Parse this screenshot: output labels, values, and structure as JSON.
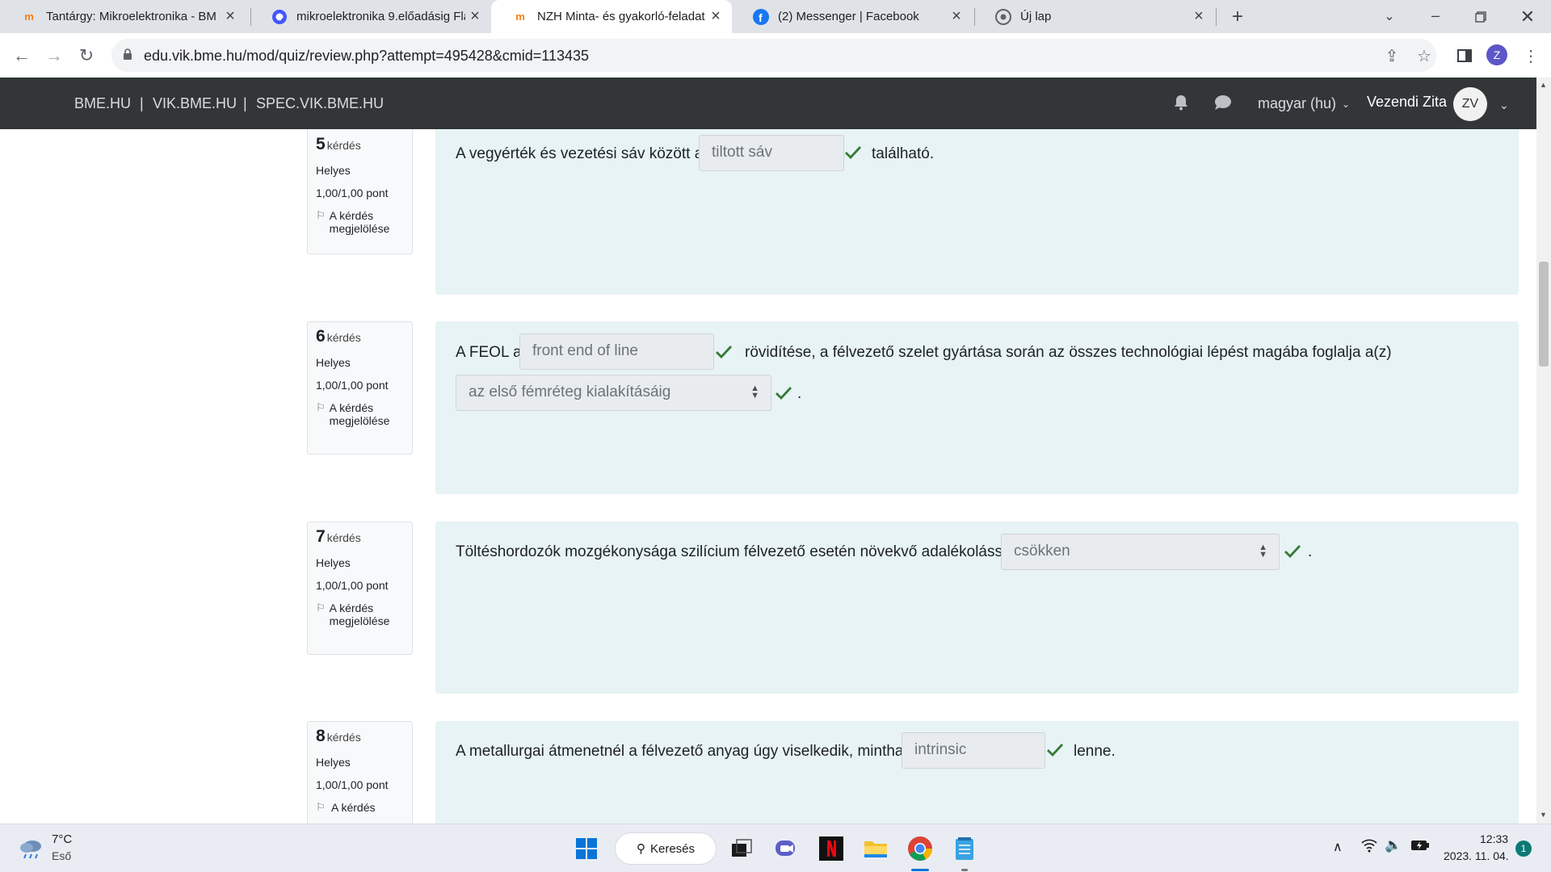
{
  "browser": {
    "tabs": [
      {
        "title": "Tantárgy: Mikroelektronika - BM",
        "favicon": "moodle-icon",
        "active": false
      },
      {
        "title": "mikroelektronika 9.előadásig Fla",
        "favicon": "quizlet-icon",
        "active": false
      },
      {
        "title": "NZH Minta- és gyakorló-feladat",
        "favicon": "moodle-icon",
        "active": true
      },
      {
        "title": "(2) Messenger | Facebook",
        "favicon": "facebook-icon",
        "active": false
      },
      {
        "title": "Új lap",
        "favicon": "chrome-icon",
        "active": false
      }
    ],
    "url": "edu.vik.bme.hu/mod/quiz/review.php?attempt=495428&cmid=113435",
    "profile_initial": "Z"
  },
  "navbar": {
    "links": [
      "BME.HU",
      "VIK.BME.HU",
      "SPEC.VIK.BME.HU"
    ],
    "language": "magyar (hu)",
    "user_name": "Vezendi Zita",
    "user_initials": "ZV"
  },
  "questions": [
    {
      "number": "5",
      "word": "kérdés",
      "status": "Helyes",
      "points": "1,00/1,00 pont",
      "flag_label": "A kérdés megjelölése",
      "text_before": "A vegyérték és vezetési sáv között a",
      "answer": "tiltott sáv",
      "text_after": "található."
    },
    {
      "number": "6",
      "word": "kérdés",
      "status": "Helyes",
      "points": "1,00/1,00 pont",
      "flag_label": "A kérdés megjelölése",
      "text_before": "A FEOL a",
      "answer": "front end of line",
      "text_after": "rövidítése, a félvezető szelet gyártása során az összes technológiai lépést magába foglalja a(z)",
      "select_answer": "az első fémréteg kialakításáig",
      "end": "."
    },
    {
      "number": "7",
      "word": "kérdés",
      "status": "Helyes",
      "points": "1,00/1,00 pont",
      "flag_label": "A kérdés megjelölése",
      "text_before": "Töltéshordozók mozgékonysága szilícium félvezető esetén növekvő adalékolással",
      "select_answer": "csökken",
      "end": "."
    },
    {
      "number": "8",
      "word": "kérdés",
      "status": "Helyes",
      "points": "1,00/1,00 pont",
      "flag_label": "A kérdés",
      "text_before": "A metallurgai átmenetnél a félvezető anyag úgy viselkedik, mintha",
      "answer": "intrinsic",
      "text_after": "lenne."
    }
  ],
  "taskbar": {
    "weather_temp": "7°C",
    "weather_desc": "Eső",
    "search_label": "Keresés",
    "time": "12:33",
    "date": "2023. 11. 04.",
    "notification_count": "1"
  },
  "colors": {
    "check": "#357a32",
    "navbar_bg": "#323639",
    "question_bg": "#e7f3f5"
  }
}
